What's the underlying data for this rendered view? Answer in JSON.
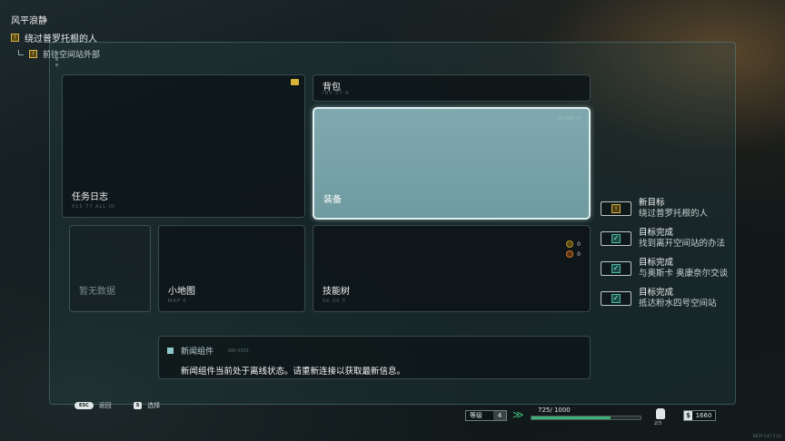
{
  "quest": {
    "title": "风平浪静",
    "main_objective": "绕过普罗托根的人",
    "sub_objective": "前往空间站外部"
  },
  "tiles": {
    "journal": {
      "label": "任务日志",
      "tiny": "015 77 ALL ID"
    },
    "bag": {
      "label": "背包",
      "tiny": "INV 07 A"
    },
    "equipment": {
      "label": "装备",
      "tiny": "DS-003 75"
    },
    "no_data": {
      "label": "暂无数据"
    },
    "minimap": {
      "label": "小地图",
      "tiny": "MAP 0"
    },
    "skill_tree": {
      "label": "技能树",
      "tiny": "SK 00 5",
      "stat_1": "0",
      "stat_2": "0"
    }
  },
  "news": {
    "title": "新闻组件",
    "tiny": "NW 0001",
    "message": "新闻组件当前处于离线状态。请重新连接以获取最新信息。"
  },
  "objectives": [
    {
      "type": "new",
      "heading": "新目标",
      "detail": "绕过普罗托根的人"
    },
    {
      "type": "done",
      "heading": "目标完成",
      "detail": "找到离开空间站的办法"
    },
    {
      "type": "done",
      "heading": "目标完成",
      "detail": "与奥斯卡 奥康奈尔交谈"
    },
    {
      "type": "done",
      "heading": "目标完成",
      "detail": "抵达粉水四号空间站"
    }
  ],
  "hints": {
    "back_key": "ESC",
    "back_label": "返回",
    "select_key": "S",
    "select_label": "选择"
  },
  "status": {
    "level_label": "等级",
    "level_value": "4",
    "xp_current": "725",
    "xp_max": "1000",
    "xp_text": "725/  1000",
    "xp_fraction": 0.725,
    "inventory_count": "2/3",
    "currency_symbol": "$",
    "currency_value": "1660",
    "version": "BETA 0.47.3 (1)"
  },
  "colors": {
    "accent": "#8ec8cc",
    "xp_fill": "#3fb07a",
    "new_objective": "#d9b24a",
    "completed_objective": "#4fb8a8"
  },
  "icons": {
    "quest": "quest-marker-icon",
    "check": "checkmark-icon",
    "xp": "xp-chevron-icon",
    "bag": "backpack-icon"
  }
}
